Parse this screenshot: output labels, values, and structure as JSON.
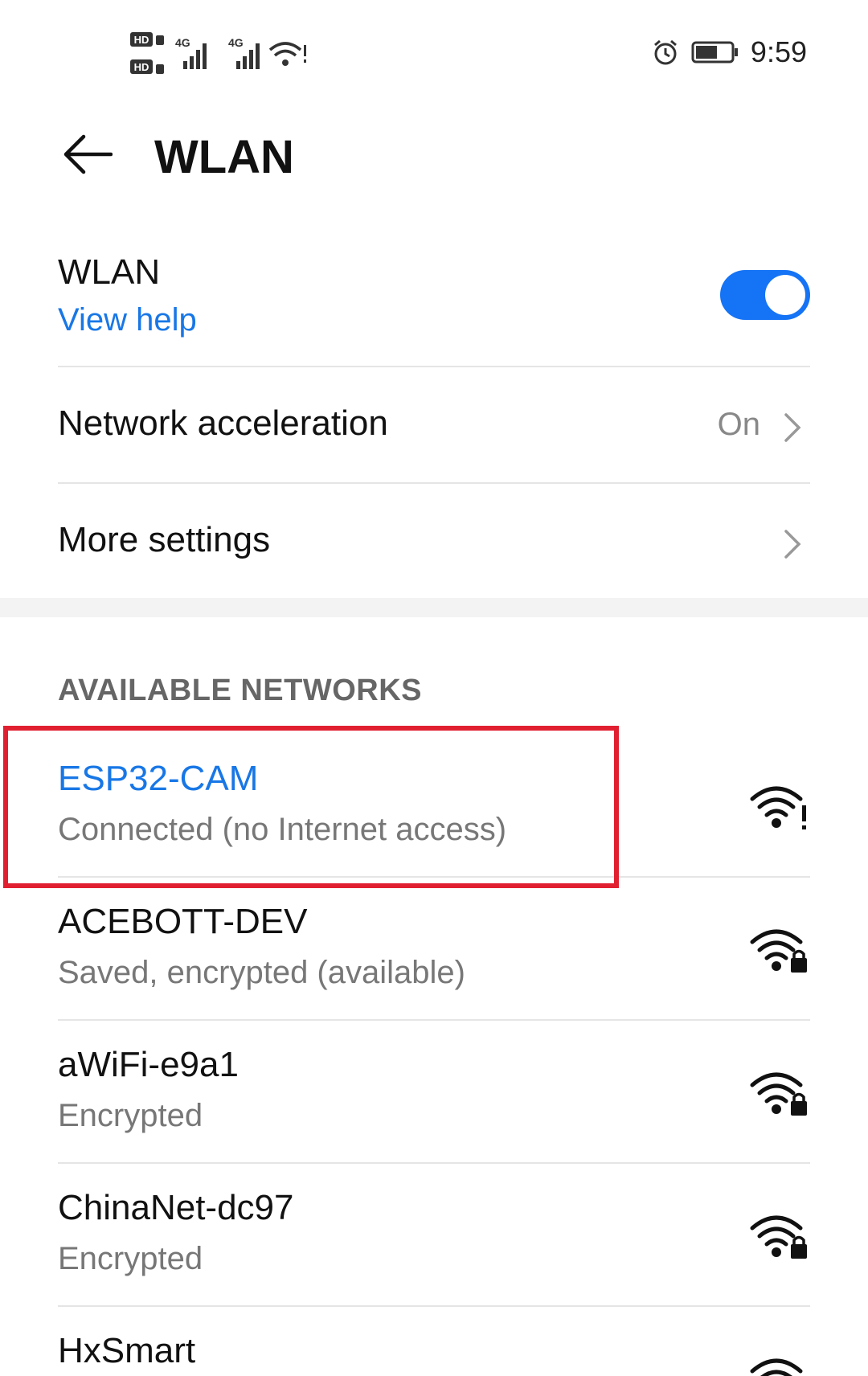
{
  "status_bar": {
    "hd1": "HD",
    "hd2": "HD",
    "sim1": "4G",
    "sim2": "4G",
    "time": "9:59"
  },
  "header": {
    "title": "WLAN"
  },
  "wlan_row": {
    "label": "WLAN",
    "help_link": "View help",
    "toggle_on": true
  },
  "network_acceleration": {
    "label": "Network acceleration",
    "value": "On"
  },
  "more_settings": {
    "label": "More settings"
  },
  "section_title": "AVAILABLE NETWORKS",
  "networks": [
    {
      "name": "ESP32-CAM",
      "status": "Connected (no Internet access)",
      "icon": "wifi-no-internet-icon",
      "connected": true
    },
    {
      "name": "ACEBOTT-DEV",
      "status": "Saved, encrypted (available)",
      "icon": "wifi-lock-icon"
    },
    {
      "name": "aWiFi-e9a1",
      "status": "Encrypted",
      "icon": "wifi-lock-icon"
    },
    {
      "name": "ChinaNet-dc97",
      "status": "Encrypted",
      "icon": "wifi-lock-icon"
    },
    {
      "name": "HxSmart",
      "status": "",
      "icon": "wifi-icon"
    }
  ],
  "colors": {
    "accent": "#1877e6",
    "toggle": "#1573f5",
    "highlight": "#e02030"
  }
}
